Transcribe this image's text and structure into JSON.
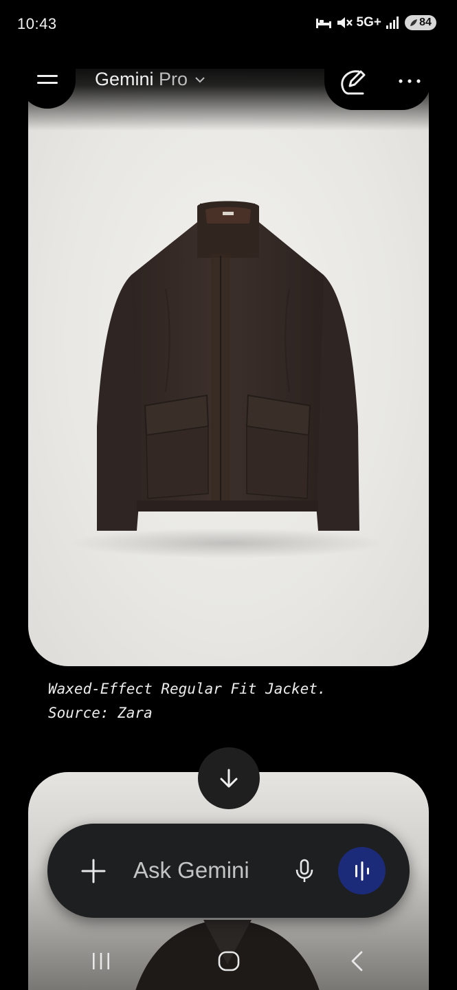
{
  "status_bar": {
    "time": "10:43",
    "network": "5G+",
    "battery": "84",
    "icons": [
      "sleep-mode-icon",
      "mute-icon",
      "signal-icon",
      "battery-icon"
    ]
  },
  "header": {
    "model_name": "Gemini",
    "model_tier": "Pro",
    "icons": [
      "menu-icon",
      "chevron-down-icon",
      "new-chat-icon",
      "more-icon"
    ]
  },
  "content": {
    "image_subject": "jacket",
    "caption_line1": "Waxed-Effect Regular Fit Jacket.",
    "caption_line2": "Source: Zara"
  },
  "composer": {
    "placeholder": "Ask Gemini",
    "icons": [
      "plus-icon",
      "mic-icon",
      "live-icon"
    ],
    "live_color": "#1c2a7a"
  },
  "nav": {
    "icons": [
      "recents-icon",
      "home-icon",
      "back-icon"
    ]
  },
  "colors": {
    "background": "#000000",
    "card_background": "#ebeae6",
    "jacket": "#372b27"
  }
}
